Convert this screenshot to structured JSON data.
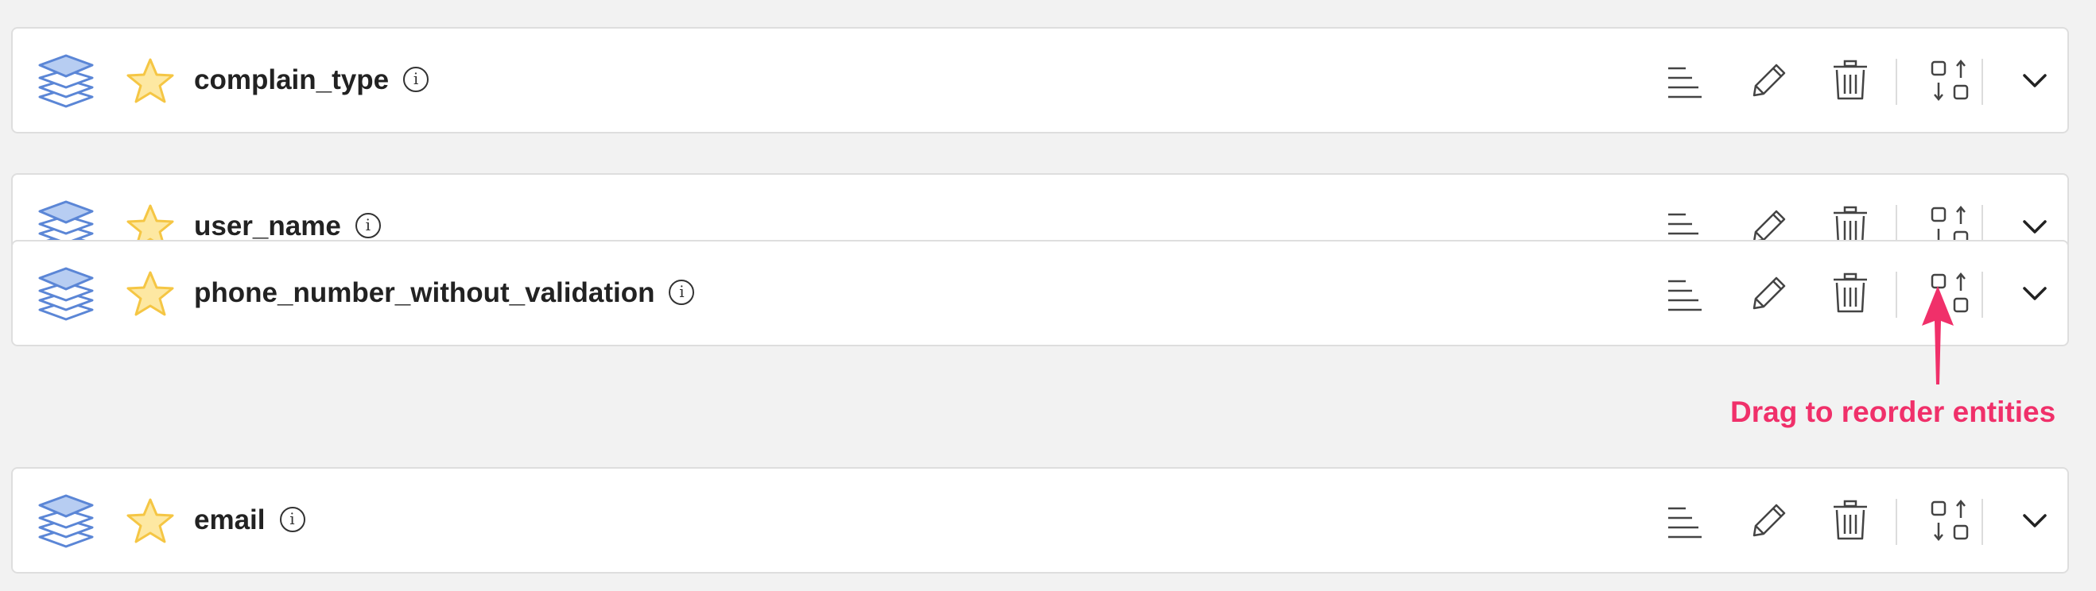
{
  "entities": [
    {
      "name": "complain_type"
    },
    {
      "name": "user_name"
    },
    {
      "name": "phone_number_without_validation"
    },
    {
      "name": "email"
    }
  ],
  "info_glyph": "i",
  "annotation": {
    "text": "Drag to reorder entities",
    "color": "#f0306a"
  },
  "colors": {
    "entity_icon": "#5b86d6",
    "entity_icon_fill": "#b7cdf2",
    "star": "#f5c644",
    "star_fill": "#fde8a2"
  },
  "icons": [
    "entity-stack-icon",
    "star-icon",
    "info-icon",
    "sort-icon",
    "pencil-icon",
    "trash-icon",
    "reorder-icon",
    "chevron-down-icon"
  ]
}
